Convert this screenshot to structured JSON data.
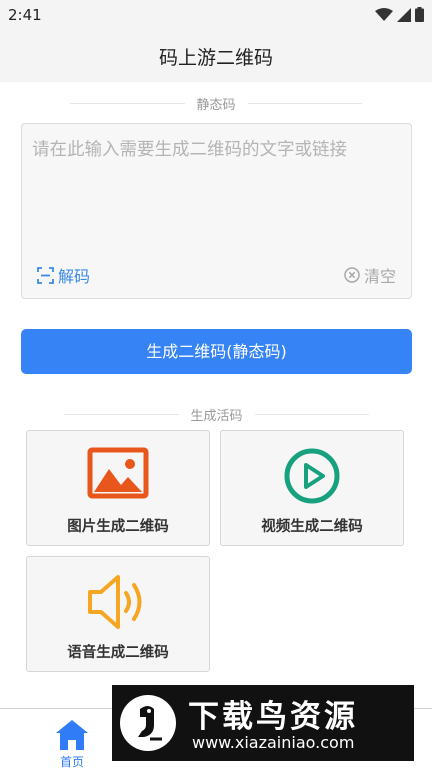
{
  "status_bar": {
    "time": "2:41"
  },
  "header": {
    "title": "码上游二维码"
  },
  "static_section": {
    "label": "静态码",
    "input_placeholder": "请在此输入需要生成二维码的文字或链接",
    "decode_label": "解码",
    "clear_label": "清空",
    "generate_button": "生成二维码(静态码)"
  },
  "dynamic_section": {
    "label": "生成活码",
    "cards": [
      {
        "label": "图片生成二维码",
        "icon": "image-icon",
        "color": "#e8561c"
      },
      {
        "label": "视频生成二维码",
        "icon": "play-circle-icon",
        "color": "#17a17e"
      },
      {
        "label": "语音生成二维码",
        "icon": "speaker-icon",
        "color": "#f5a623"
      }
    ]
  },
  "tabbar": {
    "home_label": "首页",
    "active_color": "#2f7cf6"
  },
  "watermark": {
    "brand": "下载鸟资源",
    "url": "www.xiazainiao.com"
  },
  "colors": {
    "primary": "#3583f5",
    "link": "#3b8ae6"
  }
}
